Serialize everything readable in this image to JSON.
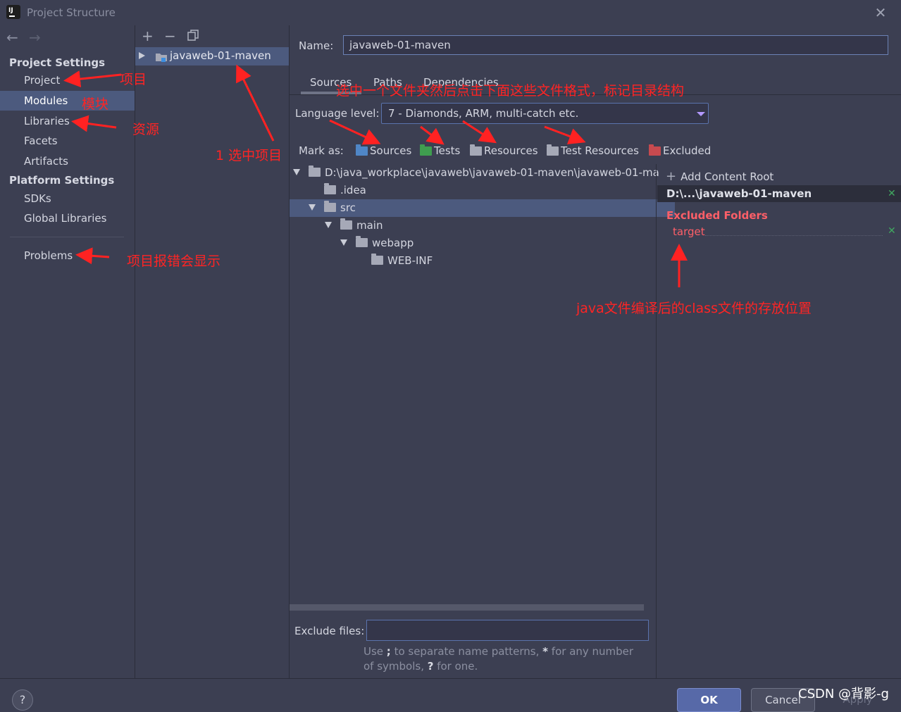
{
  "window": {
    "title": "Project Structure"
  },
  "nav": {
    "back_icon": "arrow-left-icon",
    "forward_icon": "arrow-right-icon",
    "project_settings_heading": "Project Settings",
    "items_project": [
      "Project",
      "Modules",
      "Libraries",
      "Facets",
      "Artifacts"
    ],
    "platform_settings_heading": "Platform Settings",
    "items_platform": [
      "SDKs",
      "Global Libraries"
    ],
    "problems": "Problems",
    "selected": "Modules"
  },
  "modules": {
    "toolbar": {
      "add": "+",
      "remove": "−",
      "copy_icon": "copy-icon"
    },
    "items": [
      "javaweb-01-maven"
    ]
  },
  "module_editor": {
    "name_label": "Name:",
    "name_value": "javaweb-01-maven",
    "tabs": [
      "Sources",
      "Paths",
      "Dependencies"
    ],
    "active_tab": "Sources",
    "language_level_label": "Language level:",
    "language_level_value": "7 - Diamonds, ARM, multi-catch etc.",
    "mark_as_label": "Mark as:",
    "mark_as": [
      {
        "label": "Sources",
        "color": "#4f86c6"
      },
      {
        "label": "Tests",
        "color": "#3f9e4f"
      },
      {
        "label": "Resources",
        "color": "#a6a9b7"
      },
      {
        "label": "Test Resources",
        "color": "#a6a9b7"
      },
      {
        "label": "Excluded",
        "color": "#c74a4f"
      }
    ],
    "tree": [
      "D:\\java_workplace\\javaweb\\javaweb-01-maven\\javaweb-01-maven",
      ".idea",
      "src",
      "main",
      "webapp",
      "WEB-INF"
    ],
    "exclude_files_label": "Exclude files:",
    "exclude_files_value": "",
    "exclude_hint_a": "Use ",
    "exclude_hint_b": ";",
    "exclude_hint_c": " to separate name patterns, ",
    "exclude_hint_d": "*",
    "exclude_hint_e": " for any number of symbols, ",
    "exclude_hint_f": "?",
    "exclude_hint_g": " for one."
  },
  "content_roots": {
    "add_label": "Add Content Root",
    "root_path": "D:\\...\\javaweb-01-maven",
    "excluded_heading": "Excluded Folders",
    "excluded_items": [
      "target"
    ]
  },
  "buttons": {
    "help": "?",
    "ok": "OK",
    "cancel": "Cancel",
    "apply": "Apply"
  },
  "annotations": {
    "project": "项目",
    "modules": "模块",
    "libraries": "资源",
    "select_project": "1 选中项目",
    "problems": "项目报错会显示",
    "mark_hint": "选中一个文件夹然后点击下面这些文件格式，标记目录结构",
    "target_hint": "java文件编译后的class文件的存放位置"
  },
  "watermark": "CSDN @背影-g"
}
